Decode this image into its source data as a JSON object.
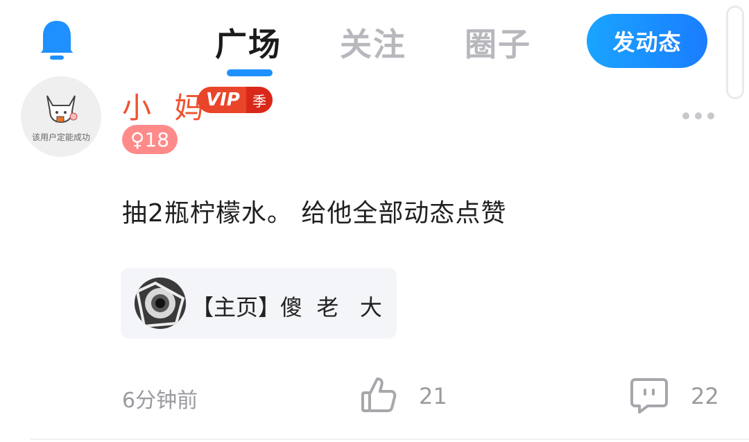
{
  "header": {
    "tabs": [
      {
        "label": "广场",
        "active": true
      },
      {
        "label": "关注",
        "active": false
      },
      {
        "label": "圈子",
        "active": false
      }
    ],
    "post_button": "发动态",
    "bell_icon": "bell-icon",
    "accent_color": "#1e90ff"
  },
  "post": {
    "avatar_caption": "该用户定能成功",
    "username": "小 妈",
    "vip_label": "VIP",
    "vip_season": "季",
    "gender_age": "♀18",
    "content": "抽2瓶柠檬水。 给他全部动态点赞",
    "quote": {
      "text": "【主页】傻  老   大"
    },
    "time": "6分钟前",
    "likes": "21",
    "comments": "22"
  }
}
